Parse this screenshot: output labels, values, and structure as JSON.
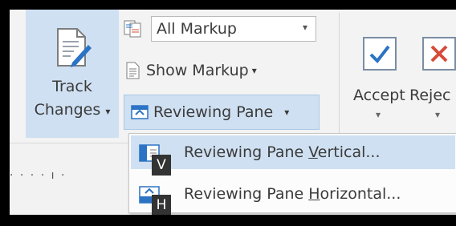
{
  "ribbon": {
    "track_changes": {
      "label_line1": "Track",
      "label_line2": "Changes",
      "caret": "▾",
      "icon": "track-changes-icon"
    },
    "display_for_review": {
      "value": "All Markup",
      "icon": "display-for-review-icon",
      "arrow": "▾"
    },
    "show_markup": {
      "label": "Show Markup",
      "caret": "▾",
      "icon": "show-markup-icon"
    },
    "reviewing_pane": {
      "label": "Reviewing Pane",
      "caret": "▾",
      "icon": "reviewing-pane-icon"
    },
    "accept": {
      "label": "Accept",
      "caret": "▾",
      "icon": "accept-check-icon"
    },
    "reject": {
      "label": "Rejec",
      "caret": "▾",
      "icon": "reject-x-icon"
    }
  },
  "ruler": {
    "marks": "· · · · ı ·"
  },
  "menu": {
    "items": [
      {
        "label_pre": "Reviewing Pane ",
        "label_key": "V",
        "label_post": "ertical...",
        "keytip": "V",
        "icon": "pane-vertical-icon",
        "highlighted": true
      },
      {
        "label_pre": "Reviewing Pane ",
        "label_key": "H",
        "label_post": "orizontal...",
        "keytip": "H",
        "icon": "pane-horizontal-icon",
        "highlighted": false
      }
    ]
  },
  "colors": {
    "accent": "#cfe0f2",
    "check": "#2b73c4",
    "reject": "#d64b3a",
    "keytip_bg": "#333333"
  }
}
